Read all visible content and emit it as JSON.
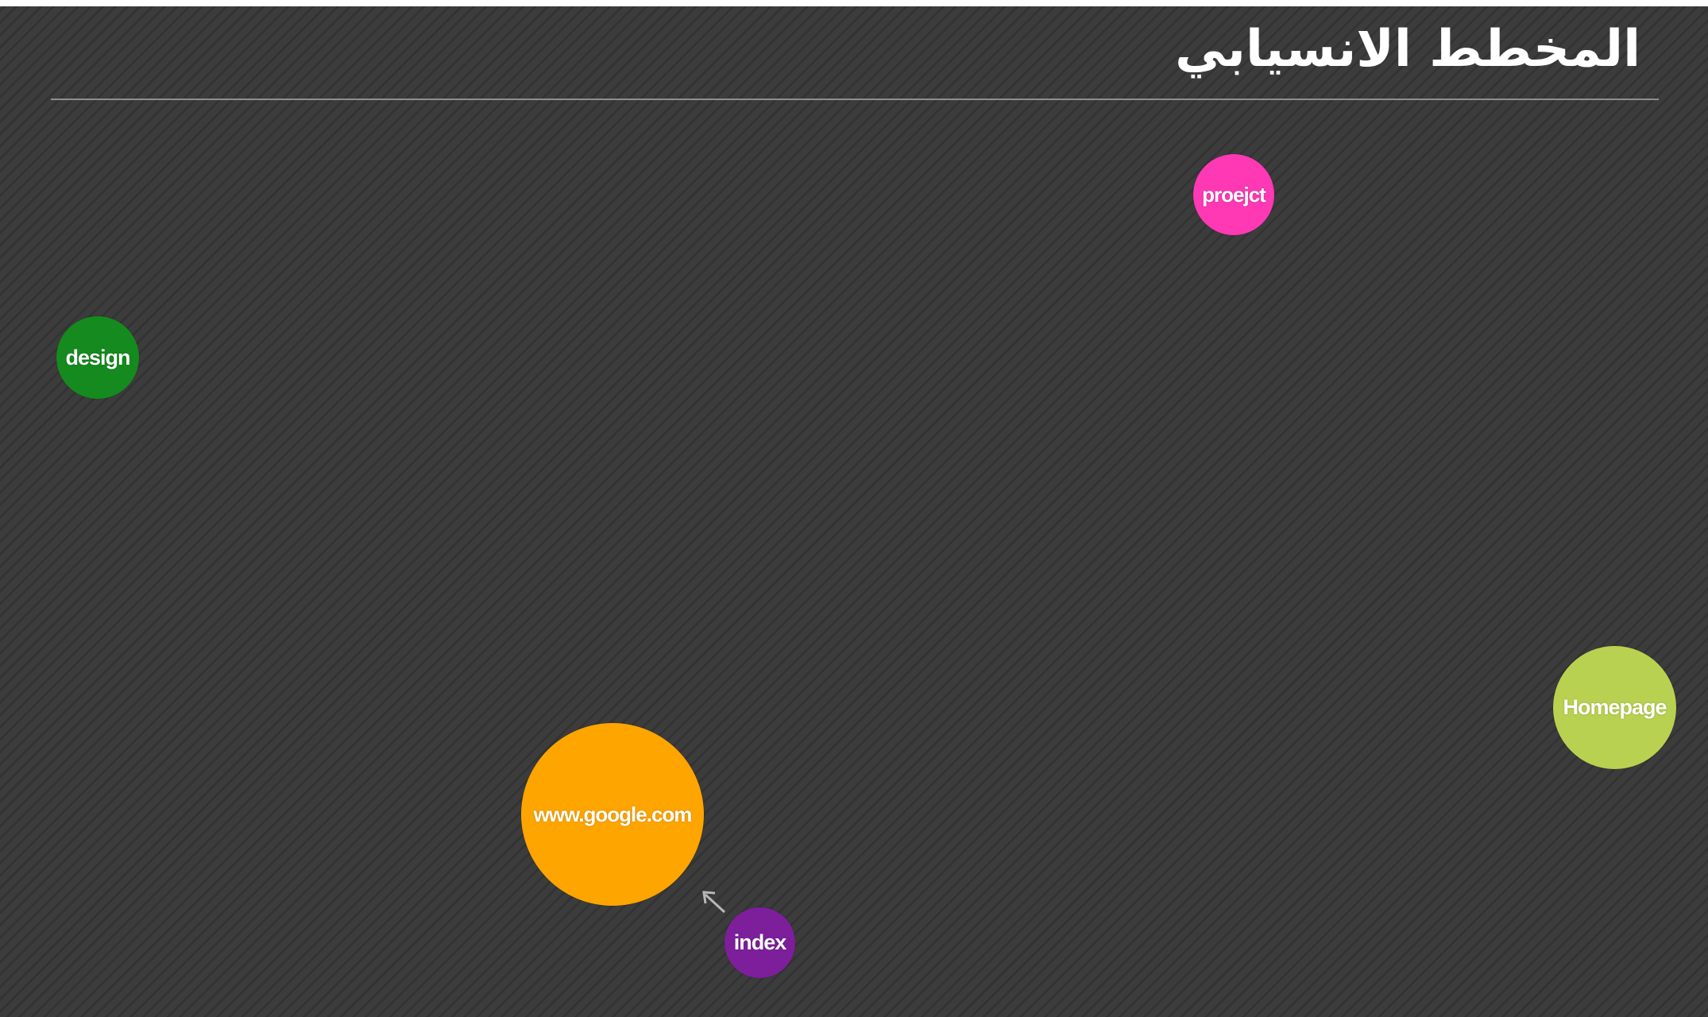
{
  "page": {
    "title": "المخطط الانسيابي"
  },
  "nodes": [
    {
      "id": "project",
      "label": "proejct",
      "color": "#ff38b4"
    },
    {
      "id": "design",
      "label": "design",
      "color": "#158a1e"
    },
    {
      "id": "homepage",
      "label": "Homepage",
      "color": "#b9d150"
    },
    {
      "id": "google",
      "label": "www.google.com",
      "color": "#ffa500"
    },
    {
      "id": "index",
      "label": "index",
      "color": "#7d1f9b"
    }
  ],
  "edges": [
    {
      "from": "index",
      "to": "google"
    }
  ],
  "colors": {
    "background": "#3a3a3a",
    "stripe": "#333333",
    "rule": "#8f8f8f",
    "arrow": "#b8b8b8"
  }
}
